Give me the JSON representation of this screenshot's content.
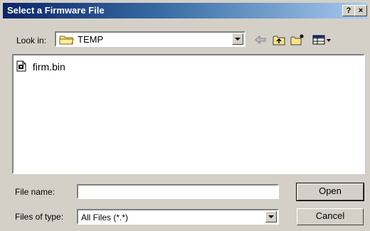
{
  "window": {
    "title": "Select a Firmware File",
    "help_label": "?",
    "close_label": "×"
  },
  "look_in": {
    "label": "Look in:",
    "value": "TEMP"
  },
  "toolbar": {
    "icons": [
      "back-arrow-icon",
      "up-one-level-icon",
      "new-folder-icon",
      "view-menu-icon"
    ]
  },
  "files": [
    {
      "name": "firm.bin",
      "icon": "binary-file-icon"
    }
  ],
  "file_name": {
    "label": "File name:",
    "value": ""
  },
  "file_type": {
    "label": "Files of type:",
    "value": "All Files (*.*)"
  },
  "buttons": {
    "open": "Open",
    "cancel": "Cancel"
  }
}
